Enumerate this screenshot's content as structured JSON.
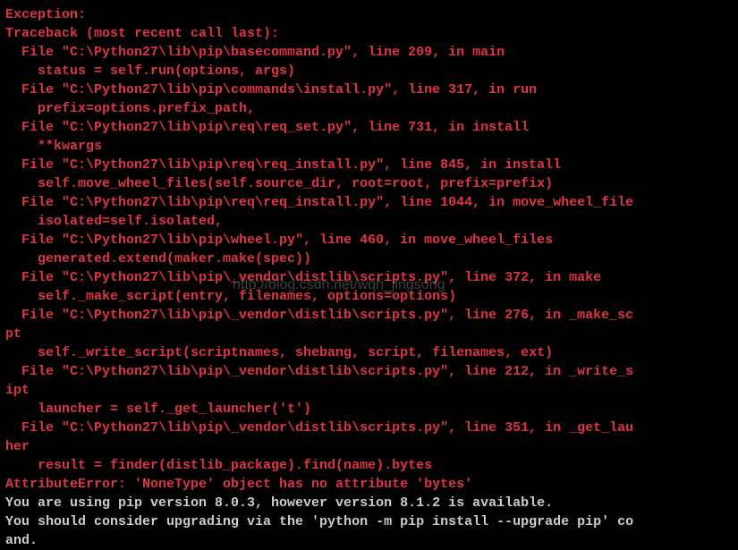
{
  "traceback": {
    "header1": "Exception:",
    "header2": "Traceback (most recent call last):",
    "frames": [
      {
        "file": "  File \"C:\\Python27\\lib\\pip\\basecommand.py\", line 209, in main",
        "code": "    status = self.run(options, args)"
      },
      {
        "file": "  File \"C:\\Python27\\lib\\pip\\commands\\install.py\", line 317, in run",
        "code": "    prefix=options.prefix_path,"
      },
      {
        "file": "  File \"C:\\Python27\\lib\\pip\\req\\req_set.py\", line 731, in install",
        "code": "    **kwargs"
      },
      {
        "file": "  File \"C:\\Python27\\lib\\pip\\req\\req_install.py\", line 845, in install",
        "code": "    self.move_wheel_files(self.source_dir, root=root, prefix=prefix)"
      },
      {
        "file": "  File \"C:\\Python27\\lib\\pip\\req\\req_install.py\", line 1044, in move_wheel_file",
        "code": "    isolated=self.isolated,"
      },
      {
        "file": "  File \"C:\\Python27\\lib\\pip\\wheel.py\", line 460, in move_wheel_files",
        "code": "    generated.extend(maker.make(spec))"
      },
      {
        "file": "  File \"C:\\Python27\\lib\\pip\\_vendor\\distlib\\scripts.py\", line 372, in make",
        "code": "    self._make_script(entry, filenames, options=options)"
      },
      {
        "file": "  File \"C:\\Python27\\lib\\pip\\_vendor\\distlib\\scripts.py\", line 276, in _make_sc",
        "wrap": "pt",
        "code": "    self._write_script(scriptnames, shebang, script, filenames, ext)"
      },
      {
        "file": "  File \"C:\\Python27\\lib\\pip\\_vendor\\distlib\\scripts.py\", line 212, in _write_s",
        "wrap": "ipt",
        "code": "    launcher = self._get_launcher('t')"
      },
      {
        "file": "  File \"C:\\Python27\\lib\\pip\\_vendor\\distlib\\scripts.py\", line 351, in _get_lau",
        "wrap": "her",
        "code": "    result = finder(distlib_package).find(name).bytes"
      }
    ],
    "error": "AttributeError: 'NoneType' object has no attribute 'bytes'"
  },
  "info": {
    "line1": "You are using pip version 8.0.3, however version 8.1.2 is available.",
    "line2": "You should consider upgrading via the 'python -m pip install --upgrade pip' co",
    "line3": "and."
  },
  "watermark": "http://blog.csdn.net/wqh_jingsong"
}
